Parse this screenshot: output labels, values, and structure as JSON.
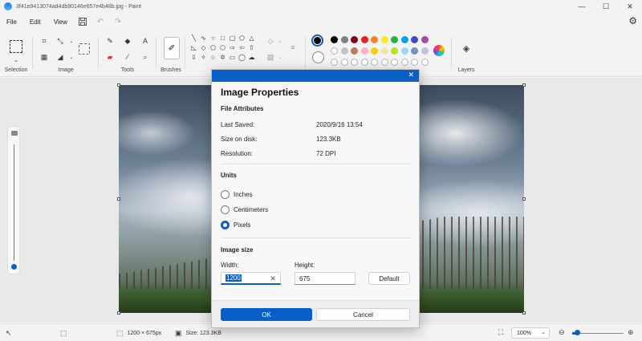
{
  "window": {
    "title": "3f41e9413074ad4db90146e657e4b48b.jpg - Paint",
    "minimize": "—",
    "maximize": "☐",
    "close": "✕"
  },
  "menu": {
    "items": [
      "File",
      "Edit",
      "View"
    ],
    "save_icon": "save-icon",
    "undo_icon": "undo-icon",
    "redo_icon": "redo-icon",
    "settings_icon": "gear-icon"
  },
  "ribbon": {
    "groups": [
      "Selection",
      "Image",
      "Tools",
      "Brushes",
      "Layers"
    ],
    "current_colors": {
      "primary": "#000000",
      "secondary": "#ffffff"
    },
    "palette_row1": [
      "#000000",
      "#7f7f7f",
      "#880015",
      "#ed1c24",
      "#ff7f27",
      "#fff200",
      "#22b14c",
      "#00a2e8",
      "#3f48cc",
      "#a349a4"
    ],
    "palette_row2": [
      "#ffffff",
      "#c3c3c3",
      "#b97a57",
      "#ffaec9",
      "#ffc90e",
      "#efe4b0",
      "#b5e61d",
      "#99d9ea",
      "#7092be",
      "#c8bfe7"
    ],
    "palette_empty_count": 10
  },
  "dialog": {
    "title": "Image Properties",
    "close": "✕",
    "file_attributes": {
      "heading": "File Attributes",
      "last_saved_label": "Last Saved:",
      "last_saved_value": "2020/9/16 13:54",
      "size_label": "Size on disk:",
      "size_value": "123.3KB",
      "resolution_label": "Resolution:",
      "resolution_value": "72 DPI"
    },
    "units": {
      "heading": "Units",
      "options": [
        "Inches",
        "Centimeters",
        "Pixels"
      ],
      "selected": "Pixels"
    },
    "image_size": {
      "heading": "Image size",
      "width_label": "Width:",
      "width_value": "1200",
      "height_label": "Height:",
      "height_value": "675",
      "default_label": "Default"
    },
    "ok_label": "OK",
    "cancel_label": "Cancel"
  },
  "status": {
    "dimensions": "1200 × 675px",
    "size": "Size: 123.3KB",
    "zoom": "100%",
    "zoom_level": 0.1
  }
}
